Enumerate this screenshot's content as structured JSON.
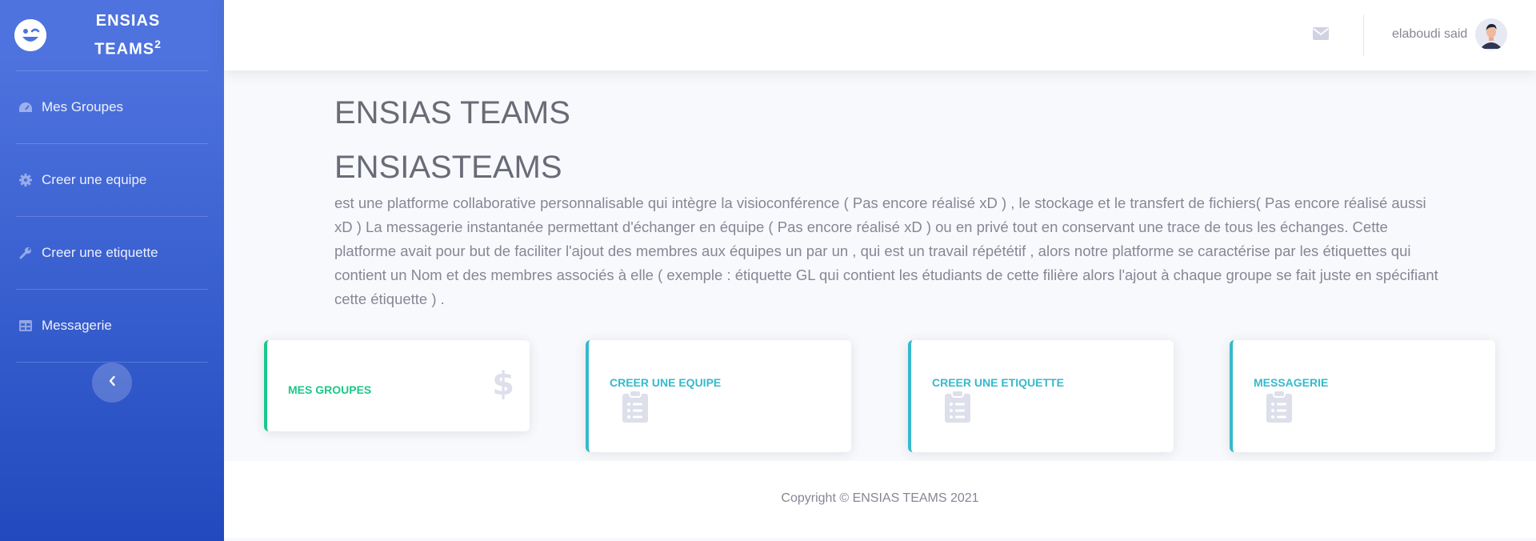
{
  "sidebar": {
    "brand_line1": "ENSIAS",
    "brand_line2": "TEAMS",
    "brand_sup": "2",
    "brand_icon": "laugh-wink-icon",
    "items": [
      {
        "label": "Mes Groupes",
        "icon": "tachometer-icon"
      },
      {
        "label": "Creer une equipe",
        "icon": "cog-icon"
      },
      {
        "label": "Creer une etiquette",
        "icon": "wrench-icon"
      },
      {
        "label": "Messagerie",
        "icon": "table-icon"
      }
    ],
    "toggle_icon": "chevron-left-icon"
  },
  "topbar": {
    "mail_icon": "envelope-icon",
    "user_name": "elaboudi said",
    "avatar_icon": "user-avatar"
  },
  "main": {
    "heading1": "ENSIAS TEAMS",
    "heading2": "ENSIASTEAMS",
    "description": "est une platforme collaborative personnalisable qui intègre la visioconférence ( Pas encore réalisé xD ) , le stockage et le transfert de fichiers( Pas encore réalisé aussi xD ) La messagerie instantanée permettant d'échanger en équipe ( Pas encore réalisé xD ) ou en privé tout en conservant une trace de tous les échanges. Cette platforme avait pour but de faciliter l'ajout des membres aux équipes un par un , qui est un travail répététif , alors notre platforme se caractérise par les étiquettes qui contient un Nom et des membres associés à elle ( exemple : étiquette GL qui contient les étudiants de cette filière alors l'ajout à chaque groupe se fait juste en spécifiant cette étiquette ) .",
    "cards": [
      {
        "title": "MES GROUPES",
        "icon": "dollar-sign-icon",
        "color": "#1cc88a"
      },
      {
        "title": "CREER UNE EQUIPE",
        "icon": "clipboard-list-icon",
        "color": "#36b9cc"
      },
      {
        "title": "CREER UNE ETIQUETTE",
        "icon": "clipboard-list-icon",
        "color": "#36b9cc"
      },
      {
        "title": "MESSAGERIE",
        "icon": "clipboard-list-icon",
        "color": "#36b9cc"
      }
    ]
  },
  "footer": {
    "copyright": "Copyright © ENSIAS TEAMS 2021"
  },
  "colors": {
    "sidebar_top": "#4e73df",
    "sidebar_bottom": "#224abe",
    "success": "#1cc88a",
    "info": "#36b9cc",
    "text": "#858796"
  }
}
